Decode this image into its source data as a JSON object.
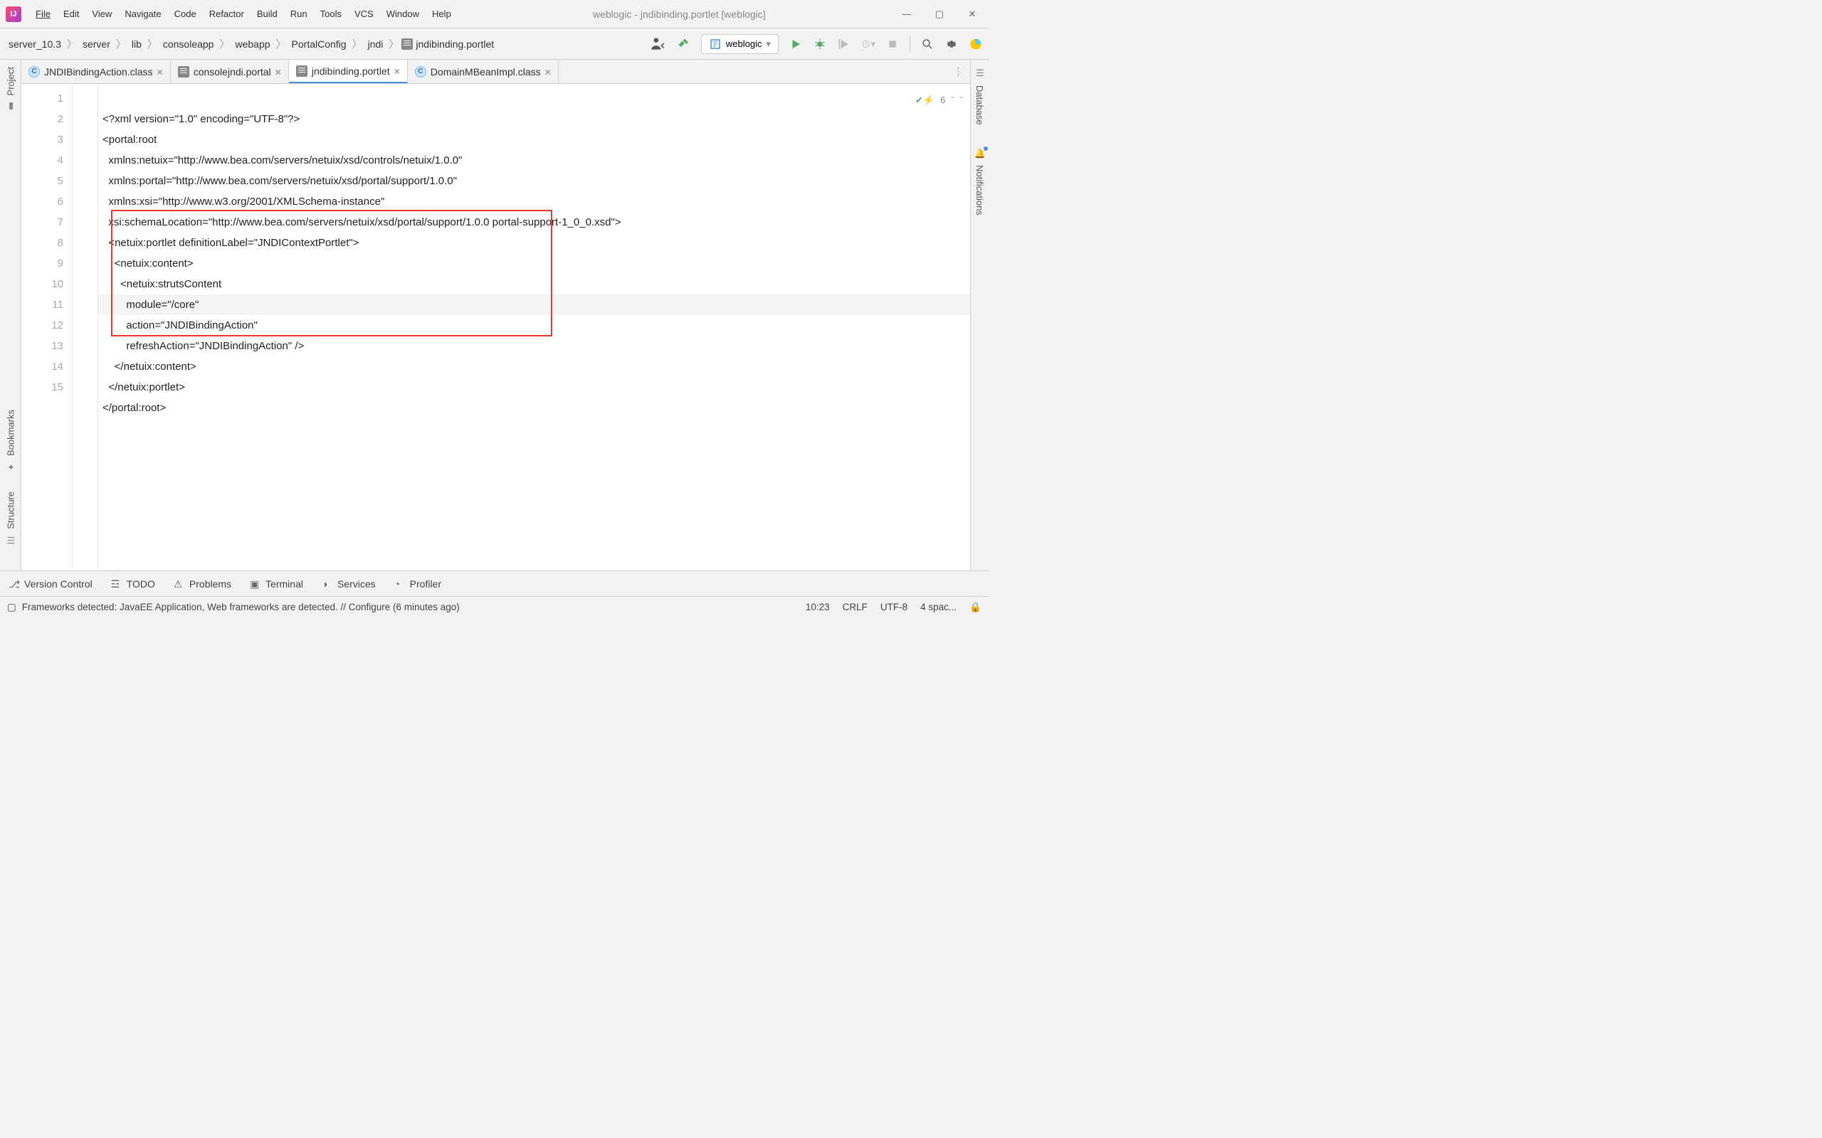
{
  "window": {
    "title": "weblogic - jndibinding.portlet [weblogic]"
  },
  "menu": [
    "File",
    "Edit",
    "View",
    "Navigate",
    "Code",
    "Refactor",
    "Build",
    "Run",
    "Tools",
    "VCS",
    "Window",
    "Help"
  ],
  "breadcrumb": [
    "server_10.3",
    "server",
    "lib",
    "consoleapp",
    "webapp",
    "PortalConfig",
    "jndi",
    "jndibinding.portlet"
  ],
  "run_config": "weblogic",
  "tabs": [
    {
      "label": "JNDIBindingAction.class",
      "icon": "c",
      "active": false
    },
    {
      "label": "consolejndi.portal",
      "icon": "x",
      "active": false
    },
    {
      "label": "jndibinding.portlet",
      "icon": "x",
      "active": true
    },
    {
      "label": "DomainMBeanImpl.class",
      "icon": "c",
      "active": false
    }
  ],
  "gutter_lines": [
    "1",
    "2",
    "3",
    "4",
    "5",
    "6",
    "7",
    "8",
    "9",
    "10",
    "11",
    "12",
    "13",
    "14",
    "15"
  ],
  "code_lines": [
    "<?xml version=\"1.0\" encoding=\"UTF-8\"?>",
    "<portal:root",
    "  xmlns:netuix=\"http://www.bea.com/servers/netuix/xsd/controls/netuix/1.0.0\"",
    "  xmlns:portal=\"http://www.bea.com/servers/netuix/xsd/portal/support/1.0.0\"",
    "  xmlns:xsi=\"http://www.w3.org/2001/XMLSchema-instance\"",
    "  xsi:schemaLocation=\"http://www.bea.com/servers/netuix/xsd/portal/support/1.0.0 portal-support-1_0_0.xsd\">",
    "  <netuix:portlet definitionLabel=\"JNDIContextPortlet\">",
    "    <netuix:content>",
    "      <netuix:strutsContent",
    "        module=\"/core\"",
    "        action=\"JNDIBindingAction\"",
    "        refreshAction=\"JNDIBindingAction\" />",
    "    </netuix:content>",
    "  </netuix:portlet>",
    "</portal:root>"
  ],
  "inspection_count": "6",
  "left_tools": [
    "Project",
    "Bookmarks",
    "Structure"
  ],
  "right_tools": [
    "Database",
    "Notifications"
  ],
  "bottom_tools": [
    "Version Control",
    "TODO",
    "Problems",
    "Terminal",
    "Services",
    "Profiler"
  ],
  "status": {
    "message": "Frameworks detected: JavaEE Application, Web frameworks are detected. // Configure (6 minutes ago)",
    "cursor": "10:23",
    "line_sep": "CRLF",
    "encoding": "UTF-8",
    "indent": "4 spac..."
  }
}
